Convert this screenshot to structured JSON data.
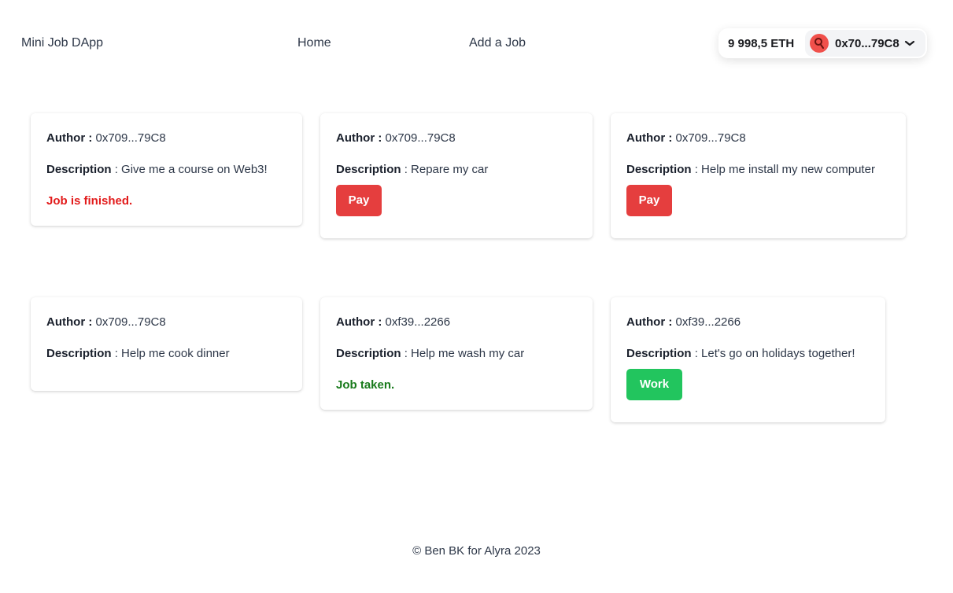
{
  "header": {
    "brand": "Mini Job DApp",
    "nav": {
      "home": "Home",
      "add_job": "Add a Job"
    },
    "wallet": {
      "balance": "9 998,5 ETH",
      "account": "0x70...79C8"
    }
  },
  "labels": {
    "author": "Author :",
    "description": "Description"
  },
  "jobs": [
    {
      "author": "0x709...79C8",
      "description": ": Give me a course on Web3!",
      "status": "Job is finished."
    },
    {
      "author": "0x709...79C8",
      "description": ": Repare my car",
      "action": "Pay"
    },
    {
      "author": "0x709...79C8",
      "description": ": Help me install my new computer",
      "action": "Pay"
    },
    {
      "author": "0x709...79C8",
      "description": ": Help me cook dinner"
    },
    {
      "author": "0xf39...2266",
      "description": ": Help me wash my car",
      "status": "Job taken."
    },
    {
      "author": "0xf39...2266",
      "description": ": Let's go on holidays together!",
      "action": "Work"
    }
  ],
  "colors": {
    "pay": "#e53e3e",
    "work": "#22c55e",
    "finished": "#e21b1b",
    "taken": "#187a1b"
  },
  "icons": {
    "avatar": "avatar-icon",
    "chevron": "chevron-down-icon"
  },
  "footer": "© Ben BK for Alyra 2023"
}
